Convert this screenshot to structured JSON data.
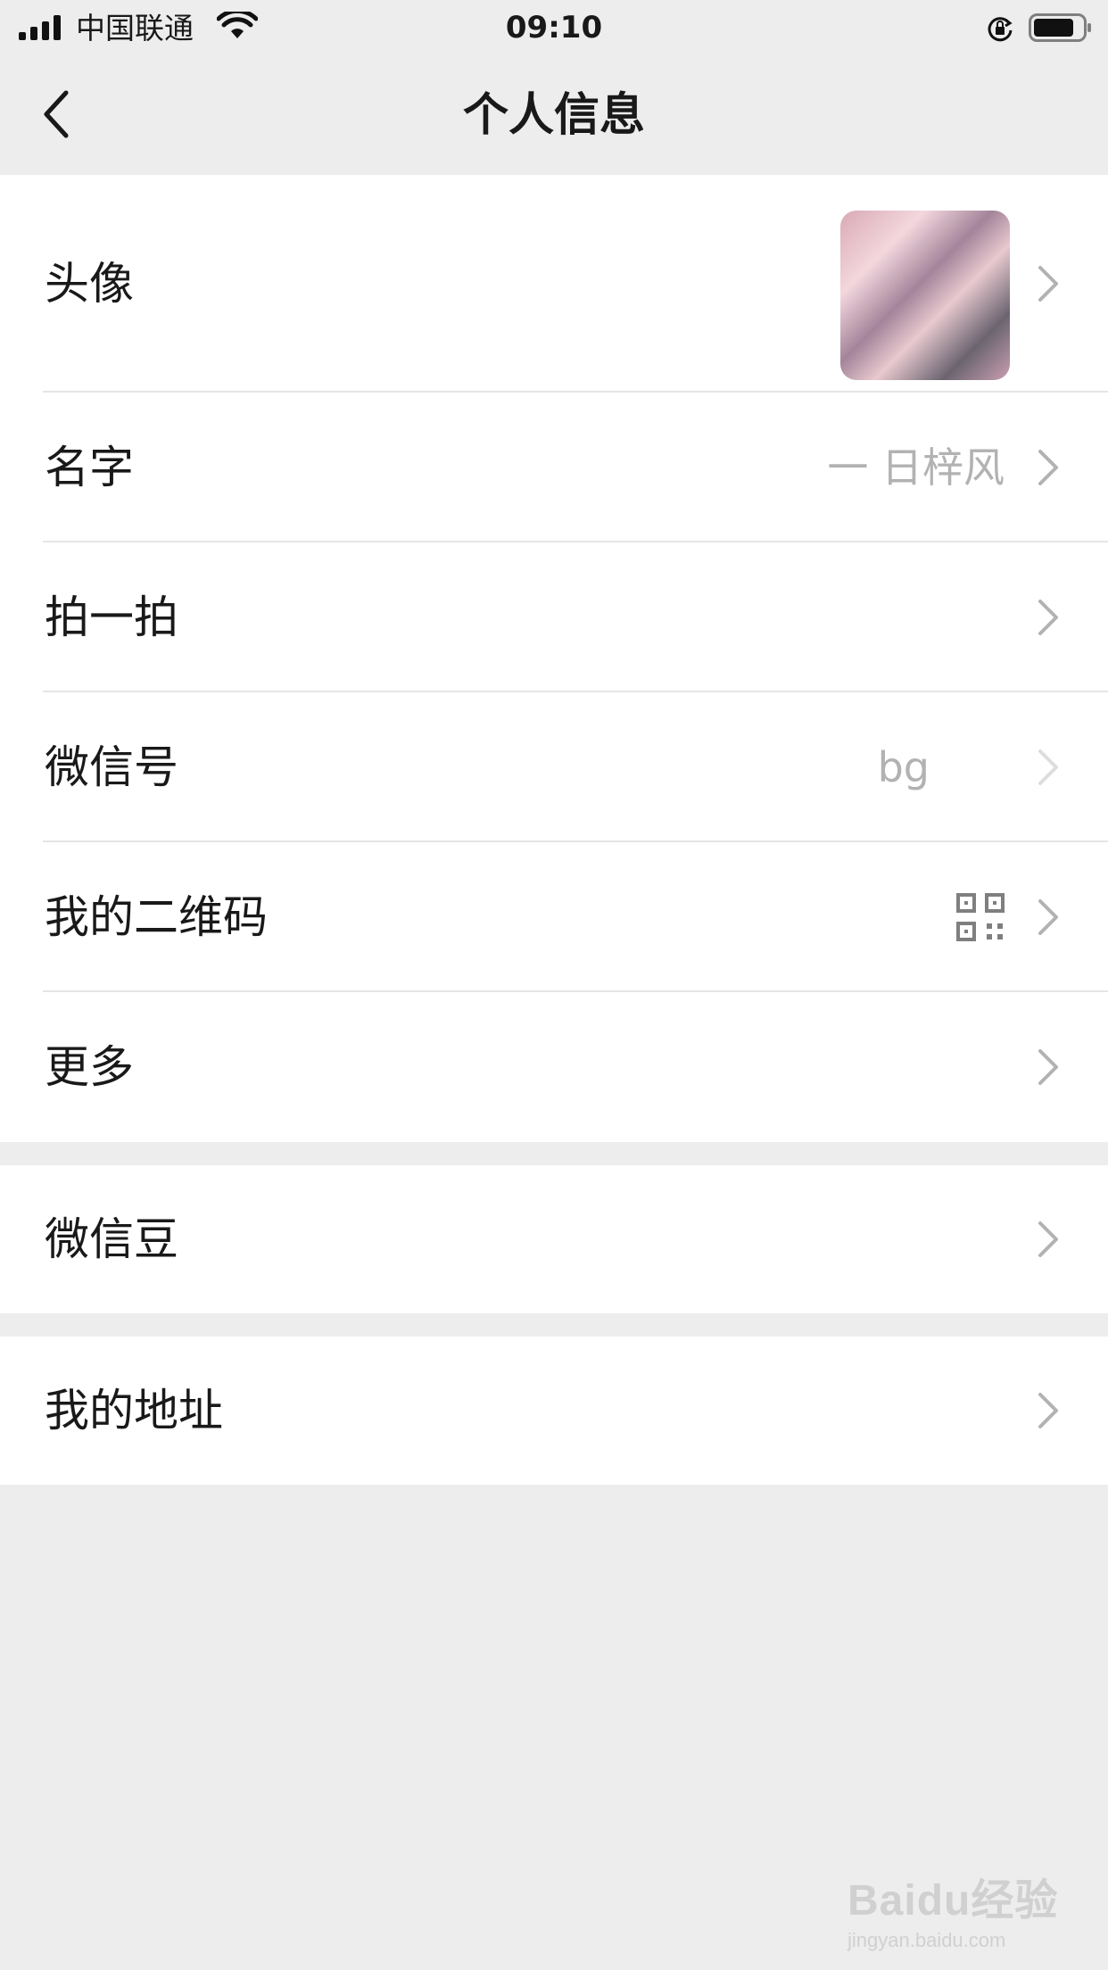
{
  "status_bar": {
    "carrier": "中国联通",
    "time": "09:10"
  },
  "nav": {
    "title": "个人信息"
  },
  "profile_items": [
    {
      "label": "头像"
    },
    {
      "label": "名字",
      "value": "一 日梓风"
    },
    {
      "label": "拍一拍"
    },
    {
      "label": "微信号",
      "value": "bg"
    },
    {
      "label": "我的二维码"
    },
    {
      "label": "更多"
    }
  ],
  "wechat_beans": {
    "label": "微信豆"
  },
  "my_address": {
    "label": "我的地址"
  },
  "watermark": {
    "logo": "Baidu经验",
    "url": "jingyan.baidu.com"
  },
  "colors": {
    "background": "#ededed",
    "cell": "#ffffff",
    "text": "#191919",
    "secondary": "#b2b2b2",
    "divider": "#e5e5e5"
  }
}
